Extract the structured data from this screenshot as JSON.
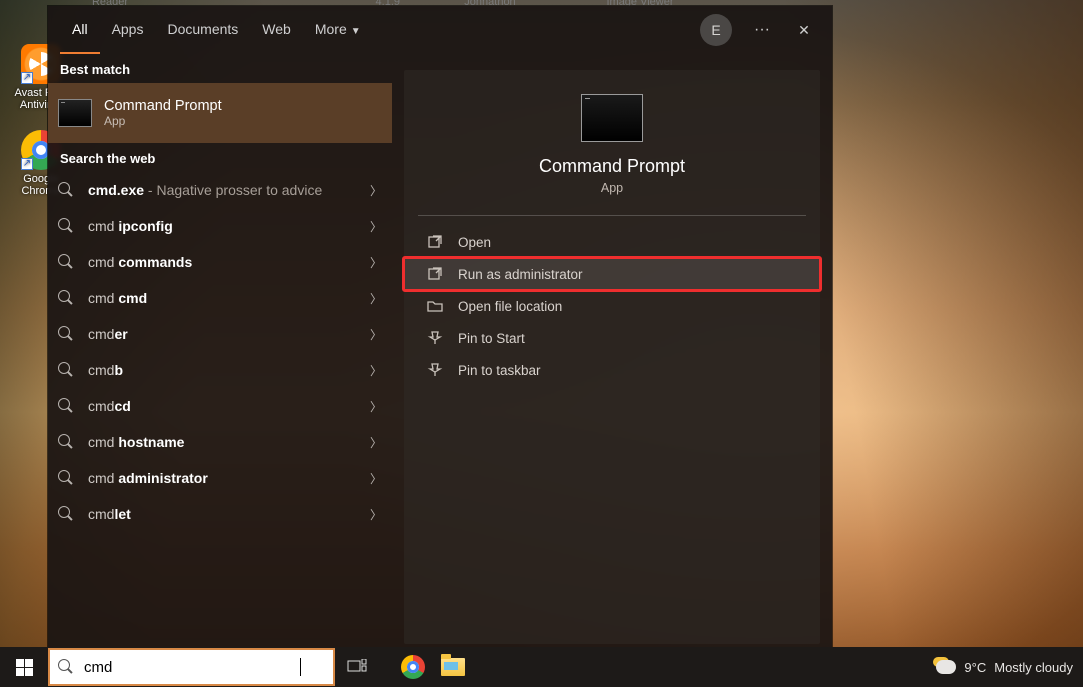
{
  "desktop": {
    "icons": [
      {
        "label": "Avast Free Antivirus"
      },
      {
        "label": "Google Chrome"
      }
    ],
    "bg_hints": [
      "Reader",
      "4.1.9",
      "Johnathon",
      "Image Viewer"
    ]
  },
  "tabs": {
    "items": [
      "All",
      "Apps",
      "Documents",
      "Web",
      "More"
    ],
    "selected": 0,
    "user_initial": "E"
  },
  "sections": {
    "best_match": "Best match",
    "search_web": "Search the web"
  },
  "best": {
    "title": "Command Prompt",
    "subtitle": "App"
  },
  "results": [
    {
      "pre": "",
      "bold": "cmd.exe",
      "post": "",
      "desc": " - Nagative prosser to advice"
    },
    {
      "pre": "cmd ",
      "bold": "ipconfig",
      "post": "",
      "desc": ""
    },
    {
      "pre": "cmd ",
      "bold": "commands",
      "post": "",
      "desc": ""
    },
    {
      "pre": "cmd ",
      "bold": "cmd",
      "post": "",
      "desc": ""
    },
    {
      "pre": "cmd",
      "bold": "er",
      "post": "",
      "desc": ""
    },
    {
      "pre": "cmd",
      "bold": "b",
      "post": "",
      "desc": ""
    },
    {
      "pre": "cmd",
      "bold": "cd",
      "post": "",
      "desc": ""
    },
    {
      "pre": "cmd ",
      "bold": "hostname",
      "post": "",
      "desc": ""
    },
    {
      "pre": "cmd ",
      "bold": "administrator",
      "post": "",
      "desc": ""
    },
    {
      "pre": "cmd",
      "bold": "let",
      "post": "",
      "desc": ""
    }
  ],
  "preview": {
    "title": "Command Prompt",
    "subtitle": "App",
    "actions": [
      {
        "label": "Open",
        "icon": "open",
        "highlighted": false
      },
      {
        "label": "Run as administrator",
        "icon": "admin",
        "highlighted": true
      },
      {
        "label": "Open file location",
        "icon": "folder",
        "highlighted": false
      },
      {
        "label": "Pin to Start",
        "icon": "pin",
        "highlighted": false
      },
      {
        "label": "Pin to taskbar",
        "icon": "pin",
        "highlighted": false
      }
    ]
  },
  "taskbar": {
    "search_value": "cmd",
    "weather_temp": "9°C",
    "weather_text": "Mostly cloudy"
  }
}
